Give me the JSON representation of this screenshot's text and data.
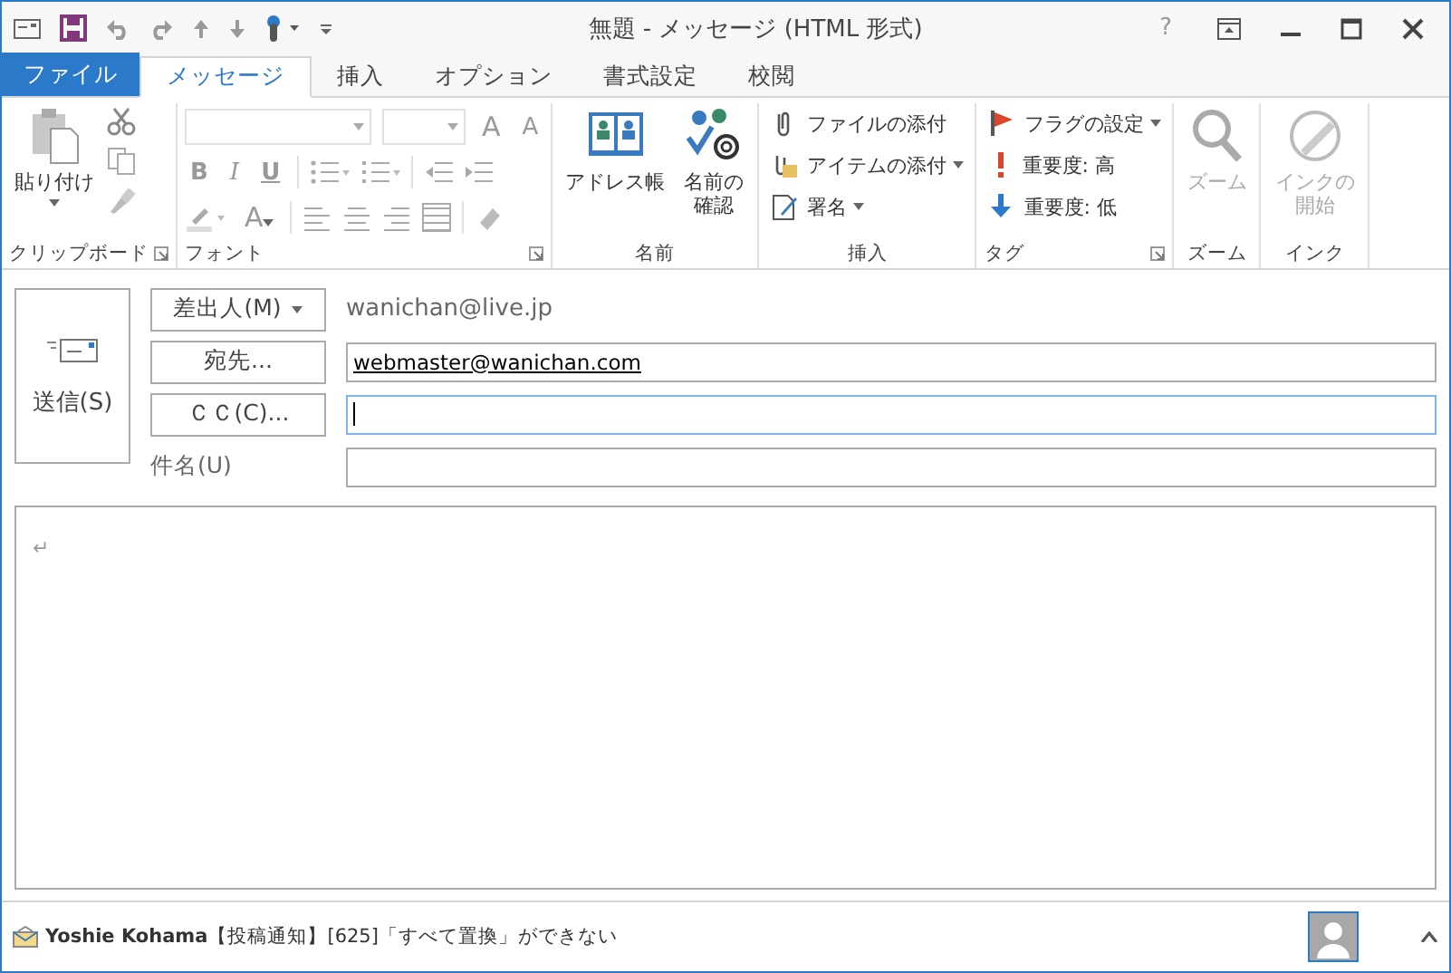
{
  "window": {
    "title": "無題 - メッセージ (HTML 形式)",
    "help": "?"
  },
  "tabs": [
    {
      "label": "ファイル",
      "kind": "file",
      "selected": false
    },
    {
      "label": "メッセージ",
      "kind": "tab",
      "selected": true
    },
    {
      "label": "挿入",
      "kind": "tab",
      "selected": false
    },
    {
      "label": "オプション",
      "kind": "tab",
      "selected": false
    },
    {
      "label": "書式設定",
      "kind": "tab",
      "selected": false
    },
    {
      "label": "校閲",
      "kind": "tab",
      "selected": false
    }
  ],
  "ribbon": {
    "groups": [
      {
        "label": "クリップボード",
        "launcher": true,
        "kind": "clipboard",
        "buttons": [
          {
            "label": "貼り付け",
            "kind": "large",
            "disabled": false,
            "dropdown": true
          }
        ]
      },
      {
        "label": "フォント",
        "launcher": true,
        "kind": "font",
        "glyphs": [
          "A",
          "A",
          "B",
          "I",
          "U",
          "A"
        ]
      },
      {
        "label": "名前",
        "launcher": false,
        "kind": "buttons",
        "buttons": [
          {
            "label": "アドレス帳",
            "kind": "large",
            "disabled": false,
            "dropdown": false
          },
          {
            "label": "名前の確認",
            "kind": "large",
            "disabled": false,
            "dropdown": false
          }
        ]
      },
      {
        "label": "挿入",
        "launcher": false,
        "kind": "buttons",
        "buttons": [
          {
            "label": "ファイルの添付",
            "kind": "small",
            "disabled": false,
            "dropdown": false
          },
          {
            "label": "アイテムの添付",
            "kind": "small",
            "disabled": false,
            "dropdown": true
          },
          {
            "label": "署名",
            "kind": "small",
            "disabled": false,
            "dropdown": true
          }
        ]
      },
      {
        "label": "タグ",
        "launcher": true,
        "kind": "buttons",
        "buttons": [
          {
            "label": "フラグの設定",
            "kind": "small",
            "disabled": false,
            "dropdown": true
          },
          {
            "label": "重要度: 高",
            "kind": "small",
            "disabled": false,
            "dropdown": false
          },
          {
            "label": "重要度: 低",
            "kind": "small",
            "disabled": false,
            "dropdown": false
          }
        ]
      },
      {
        "label": "ズーム",
        "launcher": false,
        "kind": "buttons",
        "buttons": [
          {
            "label": "ズーム",
            "kind": "large",
            "disabled": true,
            "dropdown": false
          }
        ]
      },
      {
        "label": "インク",
        "launcher": false,
        "kind": "buttons",
        "buttons": [
          {
            "label": "インクの開始",
            "kind": "large",
            "disabled": true,
            "dropdown": false
          }
        ]
      }
    ]
  },
  "compose": {
    "send": "送信(S)",
    "rows": [
      {
        "kind": "from",
        "button": "差出人(M)",
        "value": "wanichan@live.jp"
      },
      {
        "kind": "field",
        "button": "宛先...",
        "value": "webmaster@wanichan.com",
        "focused": false
      },
      {
        "kind": "field",
        "button": "ＣＣ(C)...",
        "focused": true
      },
      {
        "kind": "label",
        "label": "件名(U)",
        "focused": false
      }
    ],
    "body": "↵"
  },
  "status_bar": {
    "text": "**Yoshie Kohama**【投稿通知】[625]「すべて置換」ができない"
  }
}
